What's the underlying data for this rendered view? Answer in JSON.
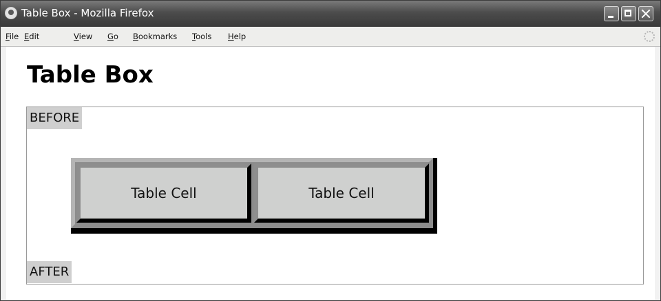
{
  "window": {
    "title": "Table Box - Mozilla Firefox"
  },
  "menubar": {
    "items": [
      {
        "mnemonic": "F",
        "rest": "ile"
      },
      {
        "mnemonic": "E",
        "rest": "dit"
      },
      {
        "mnemonic": "V",
        "rest": "iew"
      },
      {
        "mnemonic": "G",
        "rest": "o"
      },
      {
        "mnemonic": "B",
        "rest": "ookmarks"
      },
      {
        "mnemonic": "T",
        "rest": "ools"
      },
      {
        "mnemonic": "H",
        "rest": "elp"
      }
    ]
  },
  "page": {
    "heading": "Table Box",
    "before_label": "BEFORE",
    "after_label": "AFTER",
    "table": {
      "cells": [
        "Table Cell",
        "Table Cell"
      ]
    }
  },
  "icons": {
    "app": "firefox-icon",
    "throbber": "throbber-icon",
    "minimize": "minimize-icon",
    "maximize": "maximize-icon",
    "close": "close-icon"
  },
  "colors": {
    "titlebar": "#4c4c4c",
    "cell_background": "#cfd0cf",
    "marker_background": "#cfcfcf"
  }
}
